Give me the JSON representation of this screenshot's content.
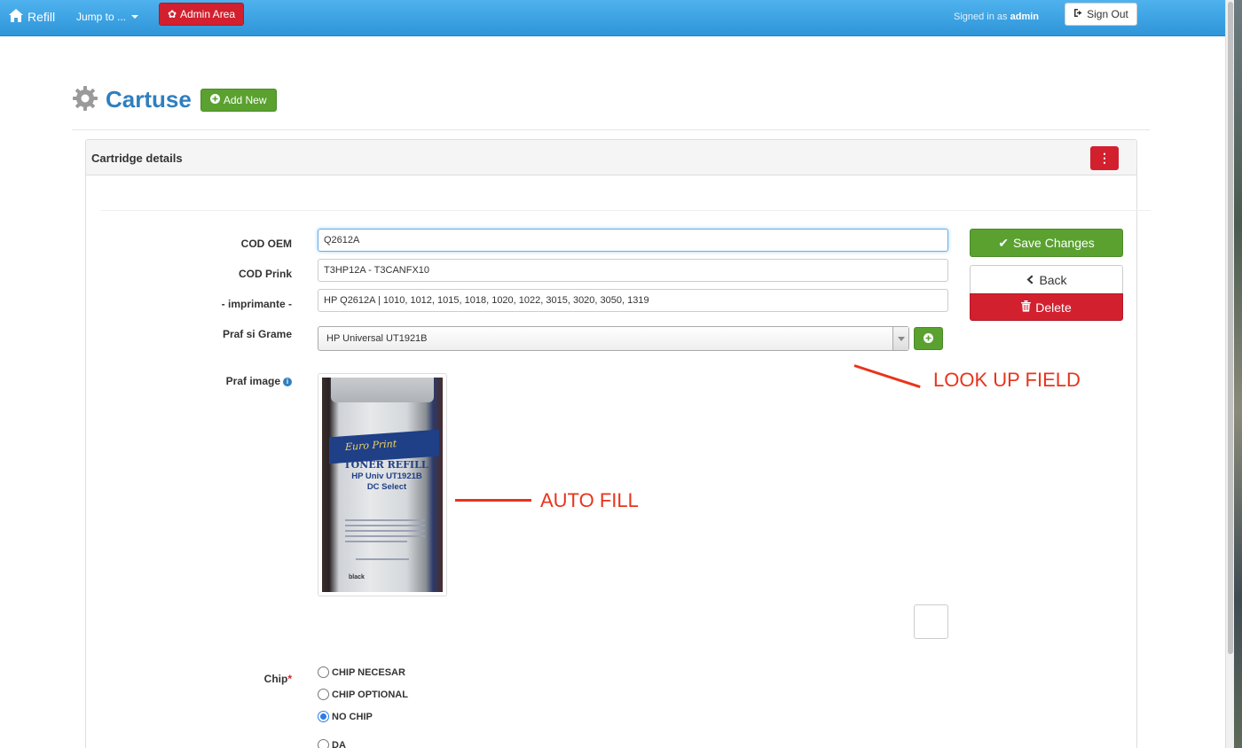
{
  "navbar": {
    "brand": "Refill",
    "jump_to": "Jump to ...",
    "admin_area": "Admin Area",
    "signed_in_prefix": "Signed in as",
    "signed_in_user": "admin",
    "sign_out": "Sign Out"
  },
  "page": {
    "title": "Cartuse",
    "add_new": "Add New"
  },
  "panel": {
    "title": "Cartridge details",
    "menu_glyph": "⋮"
  },
  "form": {
    "cod_oem": {
      "label": "COD OEM",
      "value": "Q2612A"
    },
    "cod_prink": {
      "label": "COD Prink",
      "value": "T3HP12A - T3CANFX10"
    },
    "imprimante": {
      "label": "- imprimante -",
      "value": "HP Q2612A | 1010, 1012, 1015, 1018, 1020, 1022, 3015, 3020, 3050, 1319"
    },
    "praf_grame": {
      "label": "Praf si Grame",
      "value": "HP Universal UT1921B"
    },
    "praf_image": {
      "label": "Praf image",
      "photo_text": {
        "brand": "Euro Print",
        "line1": "TONER REFILL",
        "line2": "HP Univ UT1921B",
        "line3": "DC Select",
        "bottom": "black"
      }
    },
    "chip": {
      "label": "Chip",
      "required_mark": "*",
      "options": [
        "CHIP NECESAR",
        "CHIP OPTIONAL",
        "NO CHIP",
        "DA"
      ],
      "selected": "NO CHIP"
    }
  },
  "actions": {
    "save": "Save Changes",
    "back": "Back",
    "delete": "Delete"
  },
  "annotations": {
    "lookup": "LOOK UP FIELD",
    "autofill": "AUTO FILL",
    "color": "#e8341c"
  },
  "colors": {
    "navbar": "#2e95d8",
    "primary_green": "#5aa130",
    "danger_red": "#d2202f",
    "title_blue": "#2f7fbf"
  }
}
